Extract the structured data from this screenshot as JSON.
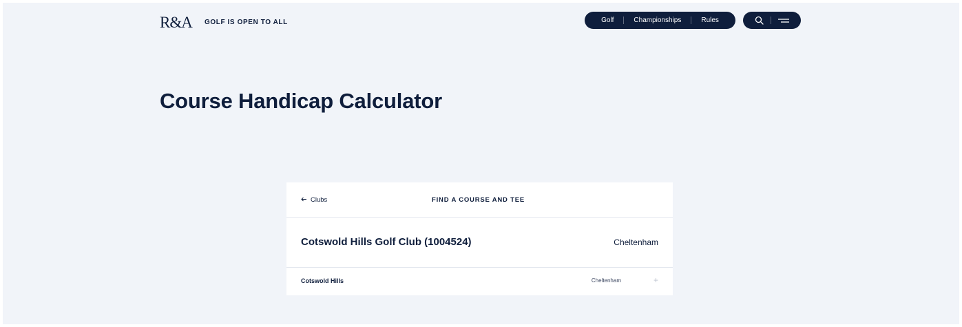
{
  "header": {
    "logo": "R&A",
    "tagline": "GOLF IS OPEN TO ALL",
    "nav": [
      "Golf",
      "Championships",
      "Rules"
    ],
    "tools": {
      "search_icon": "search-icon",
      "menu_icon": "menu-icon"
    }
  },
  "main": {
    "title": "Course Handicap Calculator"
  },
  "card": {
    "back_label": "Clubs",
    "heading": "FIND A COURSE AND TEE",
    "club": {
      "name": "Cotswold Hills Golf Club (1004524)",
      "town": "Cheltenham"
    },
    "courses": [
      {
        "name": "Cotswold Hills",
        "town": "Cheltenham",
        "action": "+"
      }
    ]
  },
  "colors": {
    "navy": "#0f1e3c",
    "page_bg": "#f1f4f9",
    "card_bg": "#ffffff"
  }
}
